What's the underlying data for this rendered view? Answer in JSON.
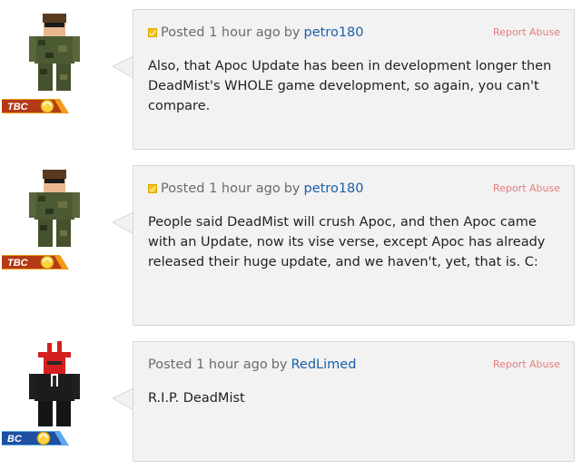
{
  "posts": [
    {
      "badge": "TBC",
      "badge_color": "#b33a14",
      "show_check": true,
      "posted": "Posted 1 hour ago",
      "by": "by",
      "user": "petro180",
      "report": "Report Abuse",
      "text": "Also, that Apoc Update has been in development longer then DeadMist's WHOLE game development, so again, you can't compare."
    },
    {
      "badge": "TBC",
      "badge_color": "#b33a14",
      "show_check": true,
      "posted": "Posted 1 hour ago",
      "by": "by",
      "user": "petro180",
      "report": "Report Abuse",
      "text": "People said DeadMist will crush Apoc, and then Apoc came with an Update, now its vise verse, except Apoc has already released their huge update, and we haven't, yet, that is. C:"
    },
    {
      "badge": "BC",
      "badge_color": "#1d4fa3",
      "show_check": false,
      "posted": "Posted 1 hour ago",
      "by": "by",
      "user": "RedLimed",
      "report": "Report Abuse",
      "text": "R.I.P. DeadMist"
    }
  ]
}
